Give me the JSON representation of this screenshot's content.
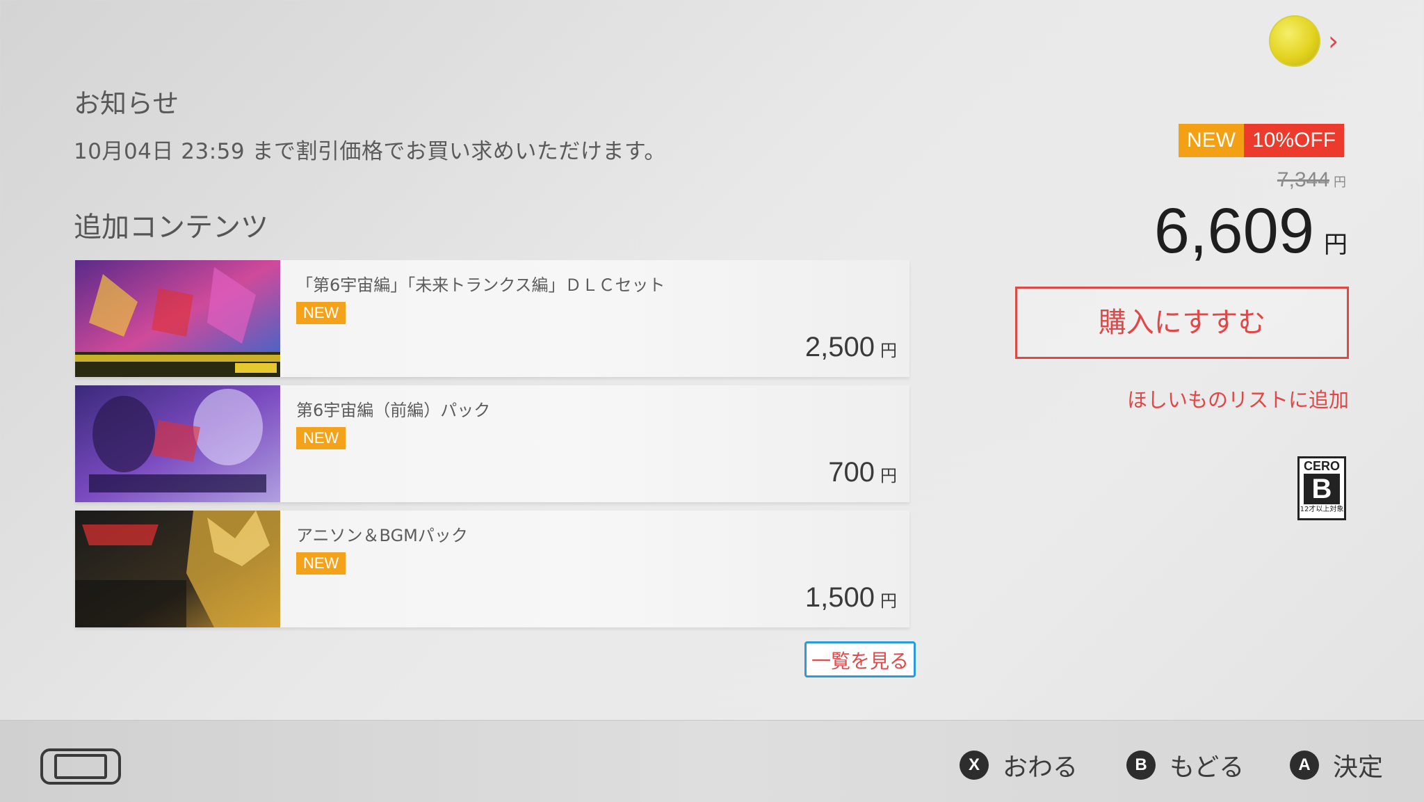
{
  "notice": {
    "heading": "お知らせ",
    "text": "10月04日 23:59 まで割引価格でお買い求めいただけます。"
  },
  "dlc": {
    "heading": "追加コンテンツ",
    "items": [
      {
        "title": "「第6宇宙編」「未来トランクス編」ＤＬＣセット",
        "badge": "NEW",
        "price": "2,500",
        "currency": "円"
      },
      {
        "title": "第6宇宙編（前編）パック",
        "badge": "NEW",
        "price": "700",
        "currency": "円"
      },
      {
        "title": "アニソン＆BGMパック",
        "badge": "NEW",
        "price": "1,500",
        "currency": "円"
      }
    ],
    "view_all_label": "一覧を見る"
  },
  "purchase": {
    "new_label": "NEW",
    "discount_label": "10%OFF",
    "original_price": "7,344",
    "price": "6,609",
    "currency": "円",
    "buy_label": "購入にすすむ",
    "wishlist_label": "ほしいものリストに追加"
  },
  "rating": {
    "org": "CERO",
    "letter": "B",
    "age": "12才以上対象"
  },
  "footer": {
    "hints": [
      {
        "button": "X",
        "label": "おわる"
      },
      {
        "button": "B",
        "label": "もどる"
      },
      {
        "button": "A",
        "label": "決定"
      }
    ]
  },
  "colors": {
    "accent": "#e04848",
    "new_badge": "#f3a014",
    "discount_badge": "#ec3a2c",
    "focus": "#2a9adf"
  },
  "icons": {
    "profile": "avatar-icon",
    "chevron": "chevron-right-icon",
    "console": "console-mode-icon"
  }
}
